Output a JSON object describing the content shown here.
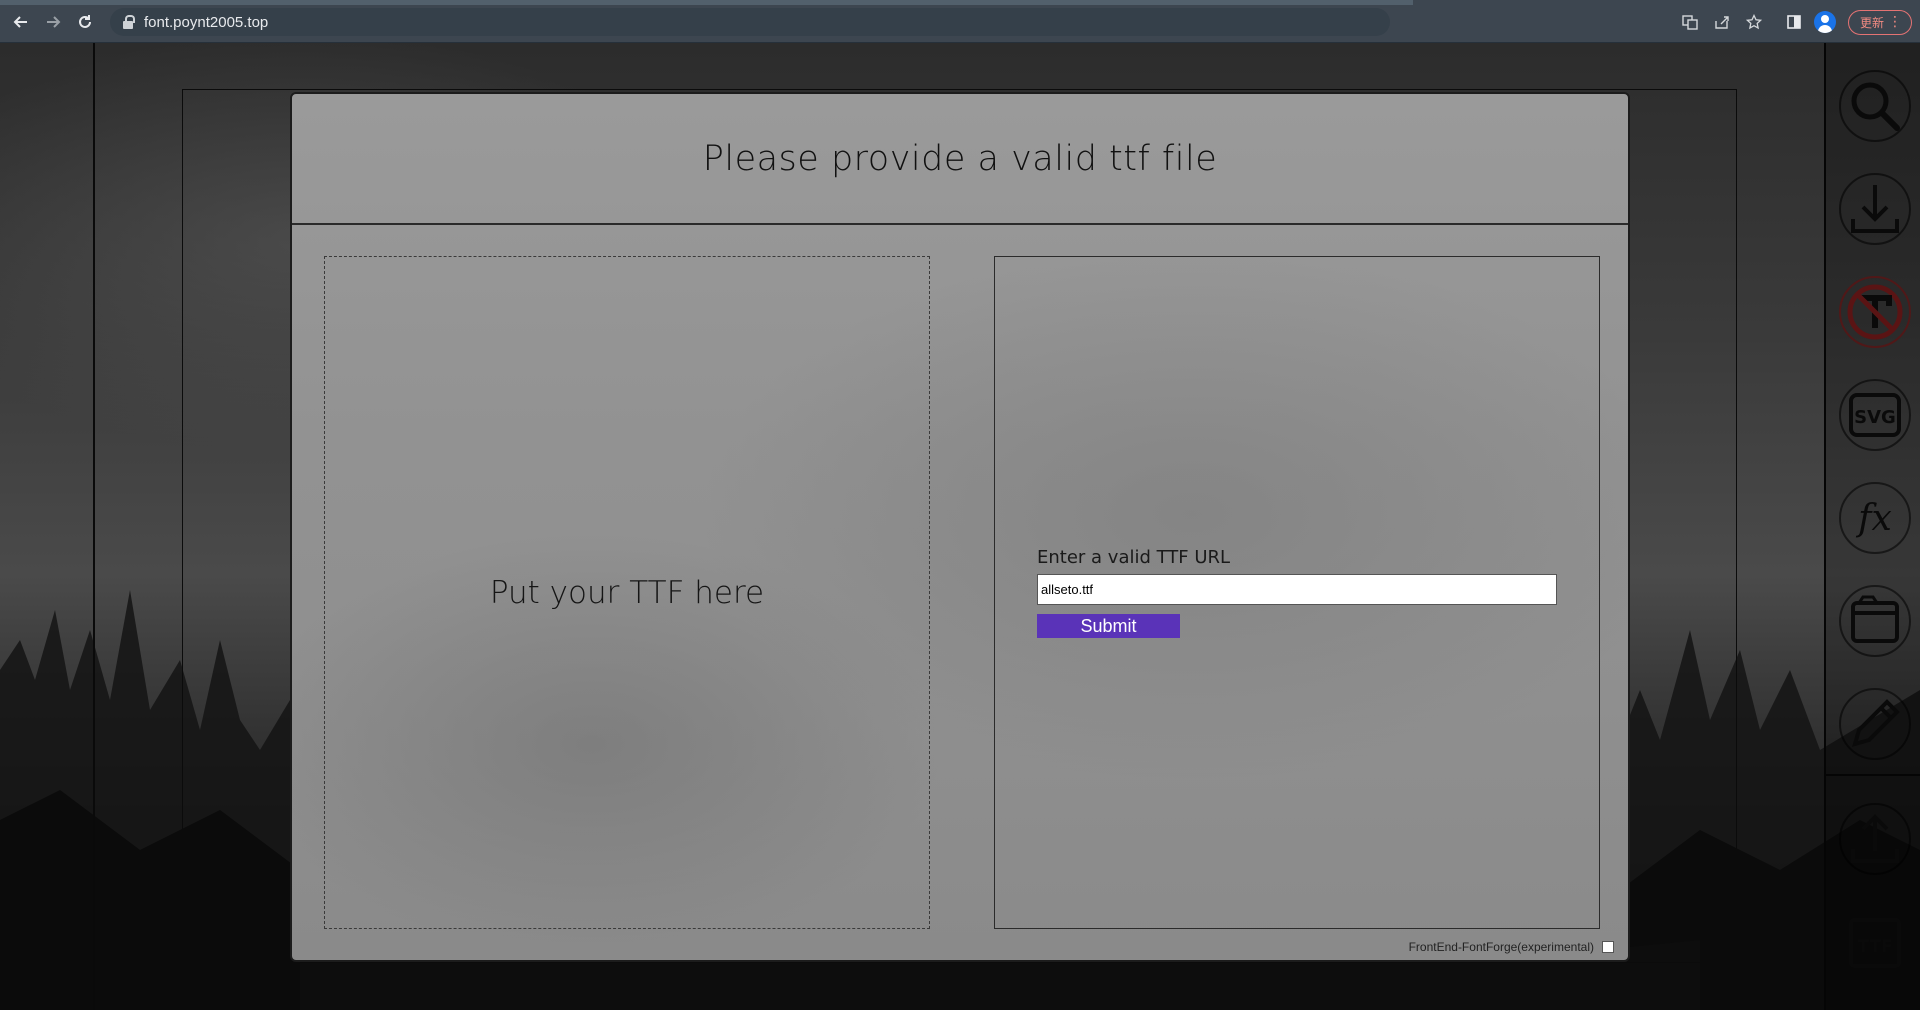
{
  "browser": {
    "url": "font.poynt2005.top",
    "update_label": "更新",
    "menu_dots": "⋮"
  },
  "modal": {
    "title": "Please provide a valid ttf file",
    "dropzone_text": "Put your TTF here",
    "url_label": "Enter a valid TTF URL",
    "url_value": "allseto.ttf",
    "submit_label": "Submit",
    "fontforge_label": "FrontEnd-FontForge(experimental)",
    "fontforge_checked": false
  },
  "sidebar": {
    "icons": [
      "search-icon",
      "download-icon",
      "no-ttf-icon",
      "svg-icon",
      "fx-icon",
      "folder-icon",
      "pencil-icon",
      "upload-icon",
      "ttf-icon"
    ]
  },
  "colors": {
    "submit_button": "#5a33b8",
    "chrome_bar": "#3d4650",
    "update_badge": "#f28b82"
  }
}
